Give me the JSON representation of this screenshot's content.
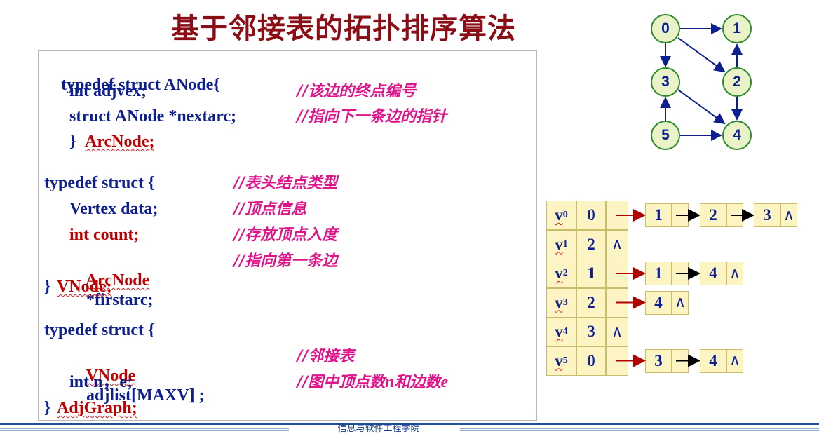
{
  "title": "基于邻接表的拓扑排序算法",
  "code": {
    "anode": {
      "header": "typedef struct ANode{",
      "adjvex_decl": "int adjvex;",
      "adjvex_comment": "//该边的终点编号",
      "nextarc_decl": "struct ANode *nextarc;",
      "nextarc_comment": "//指向下一条边的指针",
      "close_brace": "}",
      "name": "ArcNode;"
    },
    "vnode": {
      "header": "typedef struct {",
      "header_comment": "//表头结点类型",
      "data_decl": "Vertex data;",
      "data_comment": "//顶点信息",
      "count_decl": "int count;",
      "count_comment": "//存放顶点入度",
      "firstarc_type": "ArcNode",
      "firstarc_rest": "*firstarc;",
      "firstarc_comment": "//指向第一条边",
      "close_brace": "}",
      "name": "VNode;"
    },
    "adjgraph": {
      "header": "typedef struct {",
      "adjlist_type": "VNode",
      "adjlist_rest": "adjlist[MAXV] ;",
      "adjlist_comment": "//邻接表",
      "ne_decl": "int n，e;",
      "ne_comment_a": "//图中顶点数",
      "ne_comment_n": "n",
      "ne_comment_b": "和边数",
      "ne_comment_e": "e",
      "close_brace": "}",
      "name": "AdjGraph;"
    }
  },
  "graph": {
    "nodes": [
      "0",
      "1",
      "2",
      "3",
      "4",
      "5"
    ],
    "edges": [
      [
        "0",
        "1"
      ],
      [
        "0",
        "3"
      ],
      [
        "0",
        "2"
      ],
      [
        "2",
        "1"
      ],
      [
        "2",
        "4"
      ],
      [
        "3",
        "4"
      ],
      [
        "5",
        "3"
      ],
      [
        "5",
        "4"
      ]
    ]
  },
  "adjacency": {
    "nil_symbol": "∧",
    "rows": [
      {
        "v": "v",
        "sub": "0",
        "count": "0",
        "arcs": [
          "1",
          "2",
          "3"
        ]
      },
      {
        "v": "v",
        "sub": "1",
        "count": "2",
        "arcs": []
      },
      {
        "v": "v",
        "sub": "2",
        "count": "1",
        "arcs": [
          "1",
          "4"
        ]
      },
      {
        "v": "v",
        "sub": "3",
        "count": "2",
        "arcs": [
          "4"
        ]
      },
      {
        "v": "v",
        "sub": "4",
        "count": "3",
        "arcs": []
      },
      {
        "v": "v",
        "sub": "5",
        "count": "0",
        "arcs": [
          "3",
          "4"
        ]
      }
    ]
  },
  "footer": "信息与软件工程学院",
  "colors": {
    "title": "#8b0d16",
    "code_blue": "#0d1f8f",
    "code_red": "#c00000",
    "comment_pink": "#e0148a",
    "node_fill": "#eaf3c7",
    "node_border": "#2e8b2e",
    "cell_fill": "#fdf4c4",
    "arrow_red": "#b00000"
  }
}
